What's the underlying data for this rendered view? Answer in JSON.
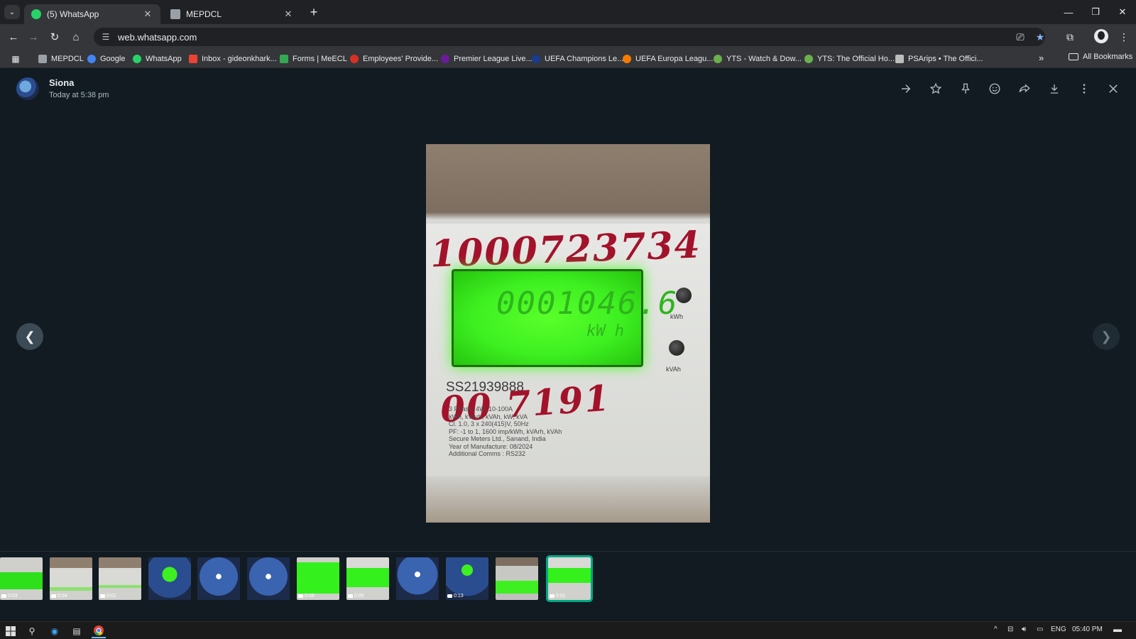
{
  "browser": {
    "tabs": [
      {
        "title": "(5) WhatsApp",
        "active": true,
        "favicon_color": "#25d366"
      },
      {
        "title": "MEPDCL",
        "active": false,
        "favicon_color": "#9aa0a6"
      }
    ],
    "url": "web.whatsapp.com",
    "bookmarks": [
      {
        "label": "MEPDCL",
        "icon_color": "#9aa0a6"
      },
      {
        "label": "Google",
        "icon_color": "#4285f4"
      },
      {
        "label": "WhatsApp",
        "icon_color": "#25d366"
      },
      {
        "label": "Inbox - gideonkhark...",
        "icon_color": "#ea4335"
      },
      {
        "label": "Forms | MeECL",
        "icon_color": "#34a853"
      },
      {
        "label": "Employees' Provide...",
        "icon_color": "#d93025"
      },
      {
        "label": "Premier League Live...",
        "icon_color": "#6a1b9a"
      },
      {
        "label": "UEFA Champions Le...",
        "icon_color": "#1a3c8f"
      },
      {
        "label": "UEFA Europa Leagu...",
        "icon_color": "#f57c00"
      },
      {
        "label": "YTS - Watch & Dow...",
        "icon_color": "#6ab04c"
      },
      {
        "label": "YTS: The Official Ho...",
        "icon_color": "#6ab04c"
      },
      {
        "label": "PSArips • The Offici...",
        "icon_color": "#bdbdbd"
      }
    ],
    "all_bookmarks_label": "All Bookmarks"
  },
  "viewer": {
    "sender_name": "Siona",
    "timestamp": "Today at 5:38 pm",
    "header_actions": [
      "forward-arrow-icon",
      "star-icon",
      "pin-icon",
      "emoji-icon",
      "share-icon",
      "download-icon",
      "menu-icon",
      "close-icon"
    ],
    "media": {
      "handwritten_top": "1000723734",
      "handwritten_mid": "00 7191",
      "lcd_reading": "0001046.6",
      "lcd_unit": "kW h",
      "serial": "SS21939888",
      "label_kwh": "kWh",
      "label_kvah": "kVAh",
      "spec_lines": [
        "3 Phase, 4W, 10-100A",
        "kWh, kVArh, kVAh, kW, kVA",
        "Cl. 1.0, 3 x 240(415)V, 50Hz",
        "PF: -1 to 1, 1600 imp/kWh, kVArh, kVAh",
        "Secure Meters Ltd., Sanand, India",
        "Year of Manufacture: 08/2024",
        "Additional Comms : RS232"
      ]
    },
    "thumbnails": [
      {
        "duration": "0:03",
        "style": "green"
      },
      {
        "duration": "0:04",
        "style": "grey"
      },
      {
        "duration": "0:01",
        "style": "grey"
      },
      {
        "duration": "",
        "style": "blue"
      },
      {
        "duration": "",
        "style": "blue"
      },
      {
        "duration": "",
        "style": "blue"
      },
      {
        "duration": "0:09",
        "style": "green"
      },
      {
        "duration": "0:05",
        "style": "green"
      },
      {
        "duration": "",
        "style": "blue"
      },
      {
        "duration": "0:13",
        "style": "blue"
      },
      {
        "duration": "",
        "style": "greygreen"
      },
      {
        "duration": "0:01",
        "style": "green",
        "selected": true
      }
    ]
  },
  "taskbar": {
    "language": "ENG",
    "time": "05:40 PM"
  }
}
